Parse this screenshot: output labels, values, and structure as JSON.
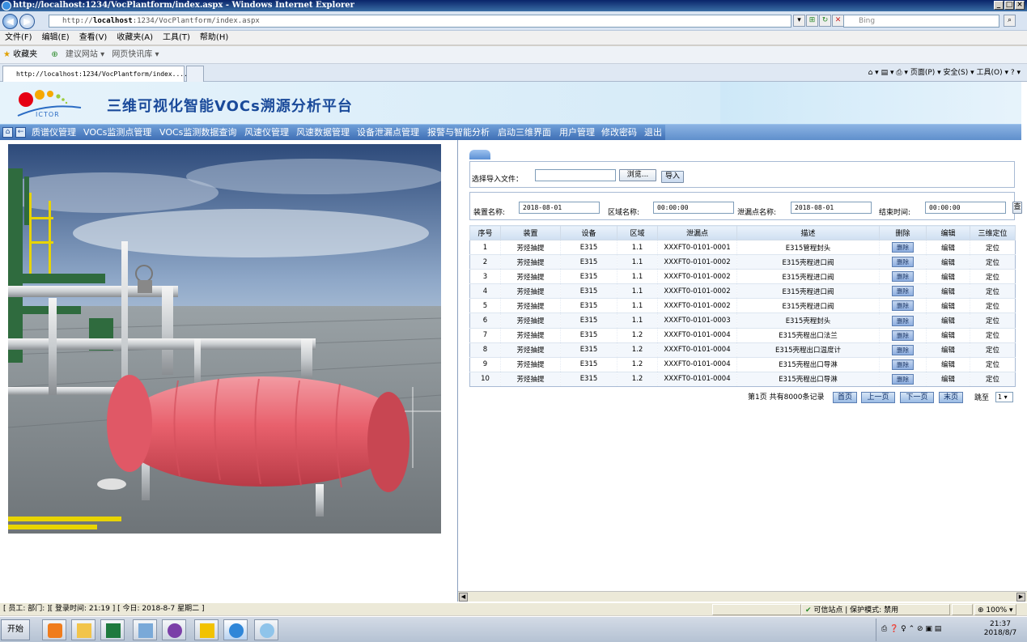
{
  "browser": {
    "window_title": "http://localhost:1234/VocPlantform/index.aspx - Windows Internet Explorer",
    "url_prefix": "http://",
    "url_host": "localhost",
    "url_rest": ":1234/VocPlantform/index.aspx",
    "search_placeholder": "Bing",
    "menu": [
      "文件(F)",
      "编辑(E)",
      "查看(V)",
      "收藏夹(A)",
      "工具(T)",
      "帮助(H)"
    ],
    "favorites_label": "收藏夹",
    "fav_links": [
      "建议网站 ▾",
      "网页快讯库 ▾"
    ],
    "tab_title": "http://localhost:1234/VocPlantform/index....",
    "commands": "页面(P) ▾   安全(S) ▾   工具(O) ▾",
    "zoom": "100%",
    "trusted_zone": "可信站点 | 保护模式: 禁用"
  },
  "app": {
    "title": "三维可视化智能VOCs溯源分析平台",
    "logo_text": "ICTOR",
    "nav": [
      "质谱仪管理",
      "VOCs监测点管理",
      "VOCs监测数据查询",
      "风速仪管理",
      "风速数据管理",
      "设备泄漏点管理",
      "报警与智能分析",
      "启动三维界面",
      "用户管理",
      "修改密码",
      "退出"
    ]
  },
  "import": {
    "label": "选择导入文件：",
    "browse": "浏览...",
    "submit": "导入"
  },
  "filters": {
    "device_label": "装置名称:",
    "device_value": "2018-08-01",
    "area_label": "区域名称:",
    "area_value": "00:00:00",
    "leak_label": "泄漏点名称:",
    "leak_value": "2018-08-01",
    "end_label": "结束时间:",
    "end_value": "00:00:00",
    "query_btn": "查"
  },
  "table": {
    "headers": [
      "序号",
      "装置",
      "设备",
      "区域",
      "泄漏点",
      "描述",
      "删除",
      "编辑",
      "三维定位"
    ],
    "delete_label": "删除",
    "edit_label": "编辑",
    "locate_label": "定位",
    "rows": [
      [
        "1",
        "芳烃抽提",
        "E315",
        "1.1",
        "XXXFT0-0101-0001",
        "E315管程封头"
      ],
      [
        "2",
        "芳烃抽提",
        "E315",
        "1.1",
        "XXXFT0-0101-0002",
        "E315壳程进口阀"
      ],
      [
        "3",
        "芳烃抽提",
        "E315",
        "1.1",
        "XXXFT0-0101-0002",
        "E315壳程进口阀"
      ],
      [
        "4",
        "芳烃抽提",
        "E315",
        "1.1",
        "XXXFT0-0101-0002",
        "E315壳程进口阀"
      ],
      [
        "5",
        "芳烃抽提",
        "E315",
        "1.1",
        "XXXFT0-0101-0002",
        "E315壳程进口阀"
      ],
      [
        "6",
        "芳烃抽提",
        "E315",
        "1.1",
        "XXXFT0-0101-0003",
        "E315壳程封头"
      ],
      [
        "7",
        "芳烃抽提",
        "E315",
        "1.2",
        "XXXFT0-0101-0004",
        "E315壳程出口法兰"
      ],
      [
        "8",
        "芳烃抽提",
        "E315",
        "1.2",
        "XXXFT0-0101-0004",
        "E315壳程出口温度计"
      ],
      [
        "9",
        "芳烃抽提",
        "E315",
        "1.2",
        "XXXFT0-0101-0004",
        "E315壳程出口导淋"
      ],
      [
        "10",
        "芳烃抽提",
        "E315",
        "1.2",
        "XXXFT0-0101-0004",
        "E315壳程出口导淋"
      ]
    ]
  },
  "pager": {
    "summary": "第1页 共有8000条记录",
    "first": "首页",
    "prev": "上一页",
    "next": "下一页",
    "last": "末页",
    "jump_label": "跳至",
    "jump_value": "1"
  },
  "status": {
    "info": "[ 员工:  部门: ][ 登录时间: 21:19 ] [ 今日: 2018-8-7  星期二 ]"
  },
  "taskbar": {
    "start": "开始",
    "time": "21:37",
    "date": "2018/8/7"
  }
}
